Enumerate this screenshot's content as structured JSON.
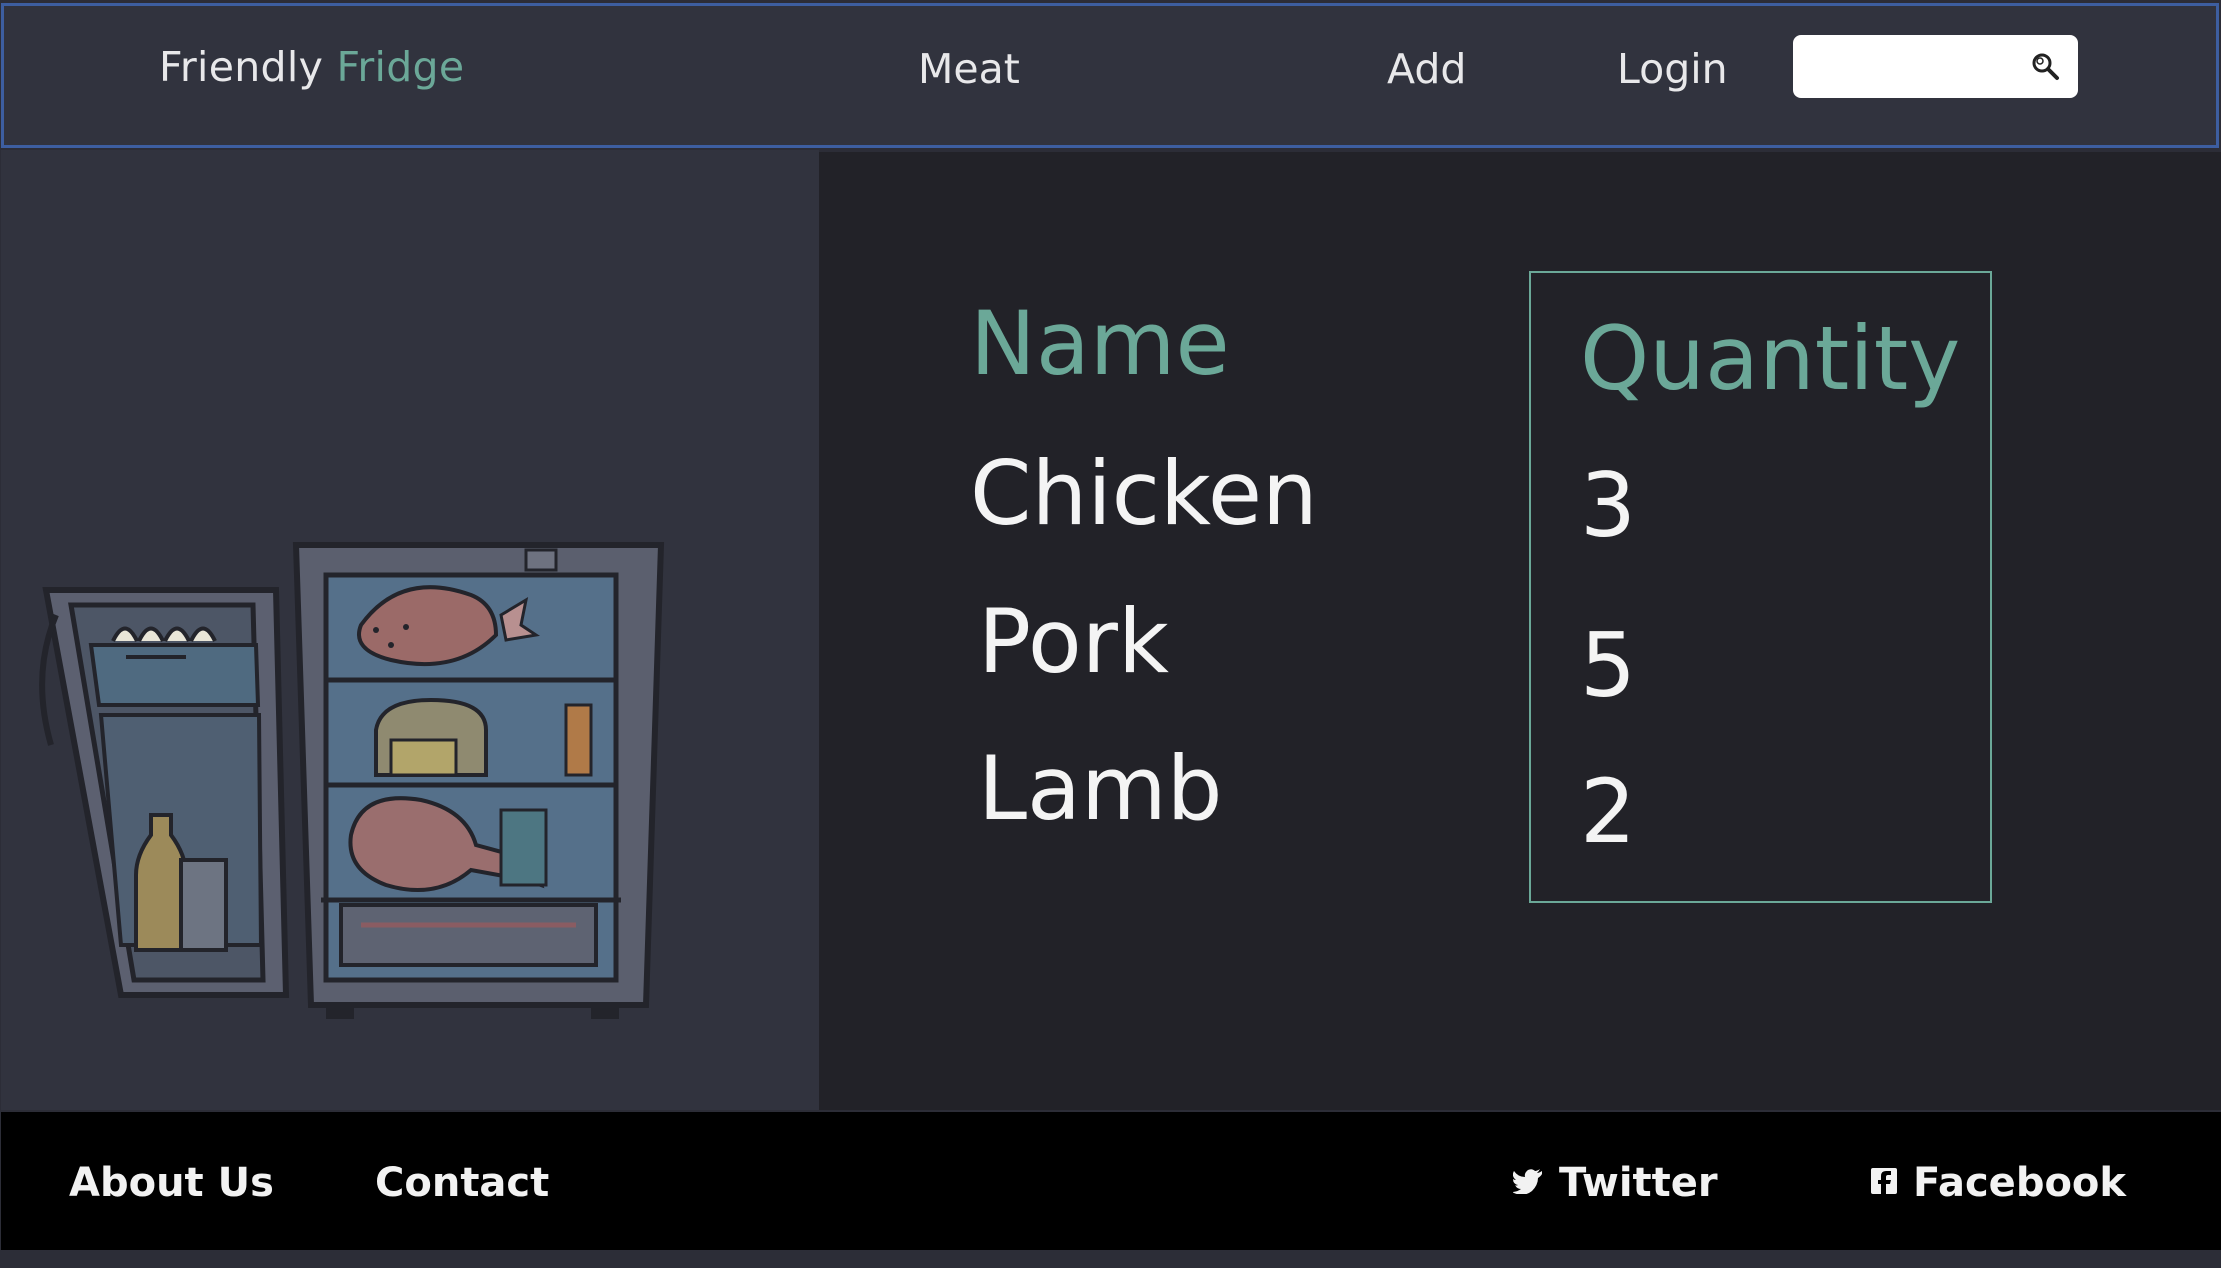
{
  "header": {
    "brand_main": "Friendly",
    "brand_accent": "Fridge",
    "nav": {
      "meat": "Meat",
      "add": "Add",
      "login": "Login"
    },
    "search": {
      "placeholder": "",
      "icon": "search-icon"
    }
  },
  "table": {
    "name_header": "Name",
    "quantity_header": "Quantity",
    "rows": [
      {
        "name": "Chicken",
        "quantity": "3"
      },
      {
        "name": "Pork",
        "quantity": "5"
      },
      {
        "name": "Lamb",
        "quantity": "2"
      }
    ]
  },
  "illustration": {
    "icon": "open-fridge-illustration"
  },
  "footer": {
    "about": "About Us",
    "contact": "Contact",
    "twitter": "Twitter",
    "facebook": "Facebook"
  },
  "colors": {
    "accent": "#6ba898",
    "header_bg": "#31333e",
    "header_border": "#3d5ea0",
    "panel_bg": "#222228",
    "footer_bg": "#000000"
  }
}
